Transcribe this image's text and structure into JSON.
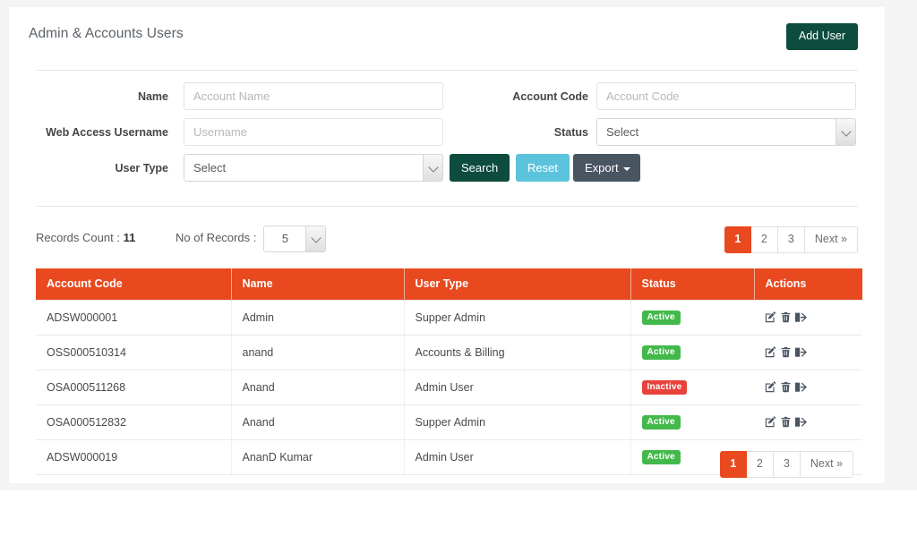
{
  "page": {
    "title": "Admin & Accounts Users",
    "add_user_label": "Add User"
  },
  "colors": {
    "primary_green": "#0d4c3e",
    "table_header_orange": "#e8491f",
    "reset_blue": "#5cc3dd",
    "export_slate": "#4a5562",
    "badge_active": "#43b94b",
    "badge_inactive": "#e8433b"
  },
  "search_form": {
    "name": {
      "label": "Name",
      "value": "",
      "placeholder": "Account Name"
    },
    "account_code": {
      "label": "Account Code",
      "value": "",
      "placeholder": "Account Code"
    },
    "web_access_username": {
      "label": "Web Access Username",
      "value": "",
      "placeholder": "Username"
    },
    "status": {
      "label": "Status",
      "selected": "Select"
    },
    "user_type": {
      "label": "User Type",
      "selected": "Select"
    },
    "buttons": {
      "search": "Search",
      "reset": "Reset",
      "export": "Export"
    }
  },
  "records_bar": {
    "count_label": "Records Count :",
    "count_value": "11",
    "no_of_records_label": "No of Records :",
    "no_of_records_selected": "5"
  },
  "pagination": {
    "pages": [
      "1",
      "2",
      "3"
    ],
    "active": "1",
    "next_label": "Next »"
  },
  "table": {
    "columns": [
      "Account Code",
      "Name",
      "User Type",
      "Status",
      "Actions"
    ],
    "rows": [
      {
        "account_code": "ADSW000001",
        "name": "Admin",
        "user_type": "Supper Admin",
        "status": "Active",
        "status_kind": "active"
      },
      {
        "account_code": "OSS000510314",
        "name": "anand",
        "user_type": "Accounts & Billing",
        "status": "Active",
        "status_kind": "active"
      },
      {
        "account_code": "OSA000511268",
        "name": "Anand",
        "user_type": "Admin User",
        "status": "Inactive",
        "status_kind": "inactive"
      },
      {
        "account_code": "OSA000512832",
        "name": "Anand",
        "user_type": "Supper Admin",
        "status": "Active",
        "status_kind": "active"
      },
      {
        "account_code": "ADSW000019",
        "name": "AnanD Kumar",
        "user_type": "Admin User",
        "status": "Active",
        "status_kind": "active"
      }
    ],
    "action_icons": [
      "edit-icon",
      "delete-icon",
      "login-as-icon"
    ]
  }
}
